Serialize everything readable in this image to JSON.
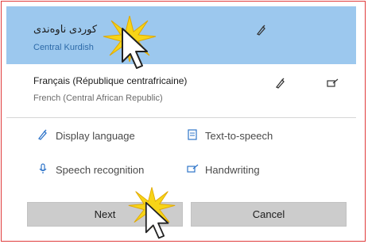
{
  "languages": [
    {
      "native": "کوردی ناوەندی",
      "english": "Central Kurdish",
      "selected": true,
      "feature_icons": [
        "display-language-icon"
      ]
    },
    {
      "native": "Français (République centrafricaine)",
      "english": "French (Central African Republic)",
      "selected": false,
      "feature_icons": [
        "display-language-icon",
        "handwriting-icon"
      ]
    }
  ],
  "features": {
    "display_language": "Display language",
    "text_to_speech": "Text-to-speech",
    "speech_recognition": "Speech recognition",
    "handwriting": "Handwriting"
  },
  "buttons": {
    "next": "Next",
    "cancel": "Cancel"
  },
  "colors": {
    "selected_bg": "#9cc8ee",
    "accent": "#2e74c9",
    "border": "#e03c3c",
    "button_bg": "#cccccc"
  }
}
